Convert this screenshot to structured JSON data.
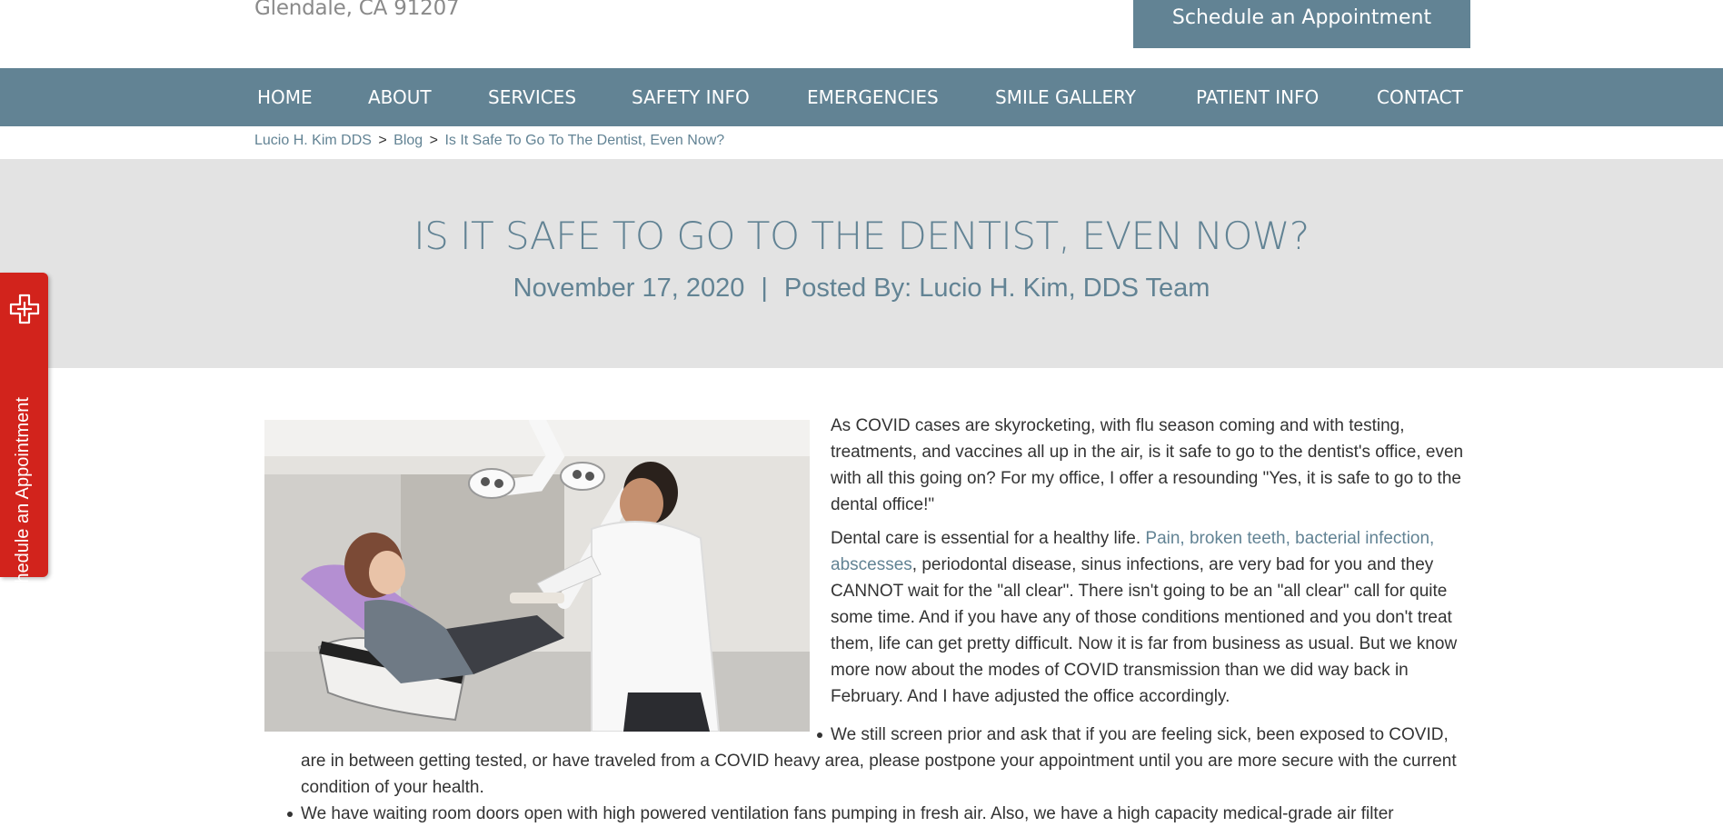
{
  "header": {
    "address_line": "Glendale, CA 91207",
    "appointment_button": "Schedule an Appointment"
  },
  "nav": {
    "items": [
      {
        "label": "HOME"
      },
      {
        "label": "ABOUT"
      },
      {
        "label": "SERVICES"
      },
      {
        "label": "SAFETY INFO"
      },
      {
        "label": "EMERGENCIES"
      },
      {
        "label": "SMILE GALLERY"
      },
      {
        "label": "PATIENT INFO"
      },
      {
        "label": "CONTACT"
      }
    ]
  },
  "breadcrumb": {
    "home": "Lucio H. Kim DDS",
    "section": "Blog",
    "current": "Is It Safe To Go To The Dentist, Even Now?",
    "separator": ">"
  },
  "post": {
    "title": "IS IT SAFE TO GO TO THE DENTIST, EVEN NOW?",
    "date": "November 17, 2020",
    "divider": "|",
    "author": "Posted By: Lucio H. Kim, DDS Team",
    "paragraph_1": "As COVID cases are skyrocketing, with flu season coming and with testing, treatments, and vaccines all up in the air, is it safe to go to the dentist's office, even with all this going on? For my office, I offer a resounding \"Yes, it is safe to go to the dental office!\"",
    "paragraph_2_lead": "Dental care is essential for a healthy life. ",
    "paragraph_2_link": "Pain, broken teeth, bacterial infection, abscesses",
    "paragraph_2_rest": ", periodontal disease, sinus infections, are very bad for you and they CANNOT wait for the \"all clear\". There isn't going to be an \"all clear\" call for quite some time. And if you have any of those conditions mentioned and you don't treat them, life can get pretty difficult. Now it is far from business as usual. But we know more now about the modes of COVID transmission than we did way back in February. And I have adjusted the office accordingly.",
    "bullet_1": "We still screen prior and ask that if you are feeling sick, been exposed to COVID, are in between getting tested, or have traveled from a COVID heavy area, please postpone your appointment until you are more secure with the current condition of your health.",
    "bullet_2": "We have waiting room doors open with high powered ventilation fans pumping in fresh air. Also, we have a high capacity medical-grade air filter"
  },
  "side_tab": {
    "label": "Schedule an Appointment"
  },
  "colors": {
    "brand": "#628394",
    "hero_background": "#e3e3e3",
    "side_tab": "#d2231c"
  }
}
